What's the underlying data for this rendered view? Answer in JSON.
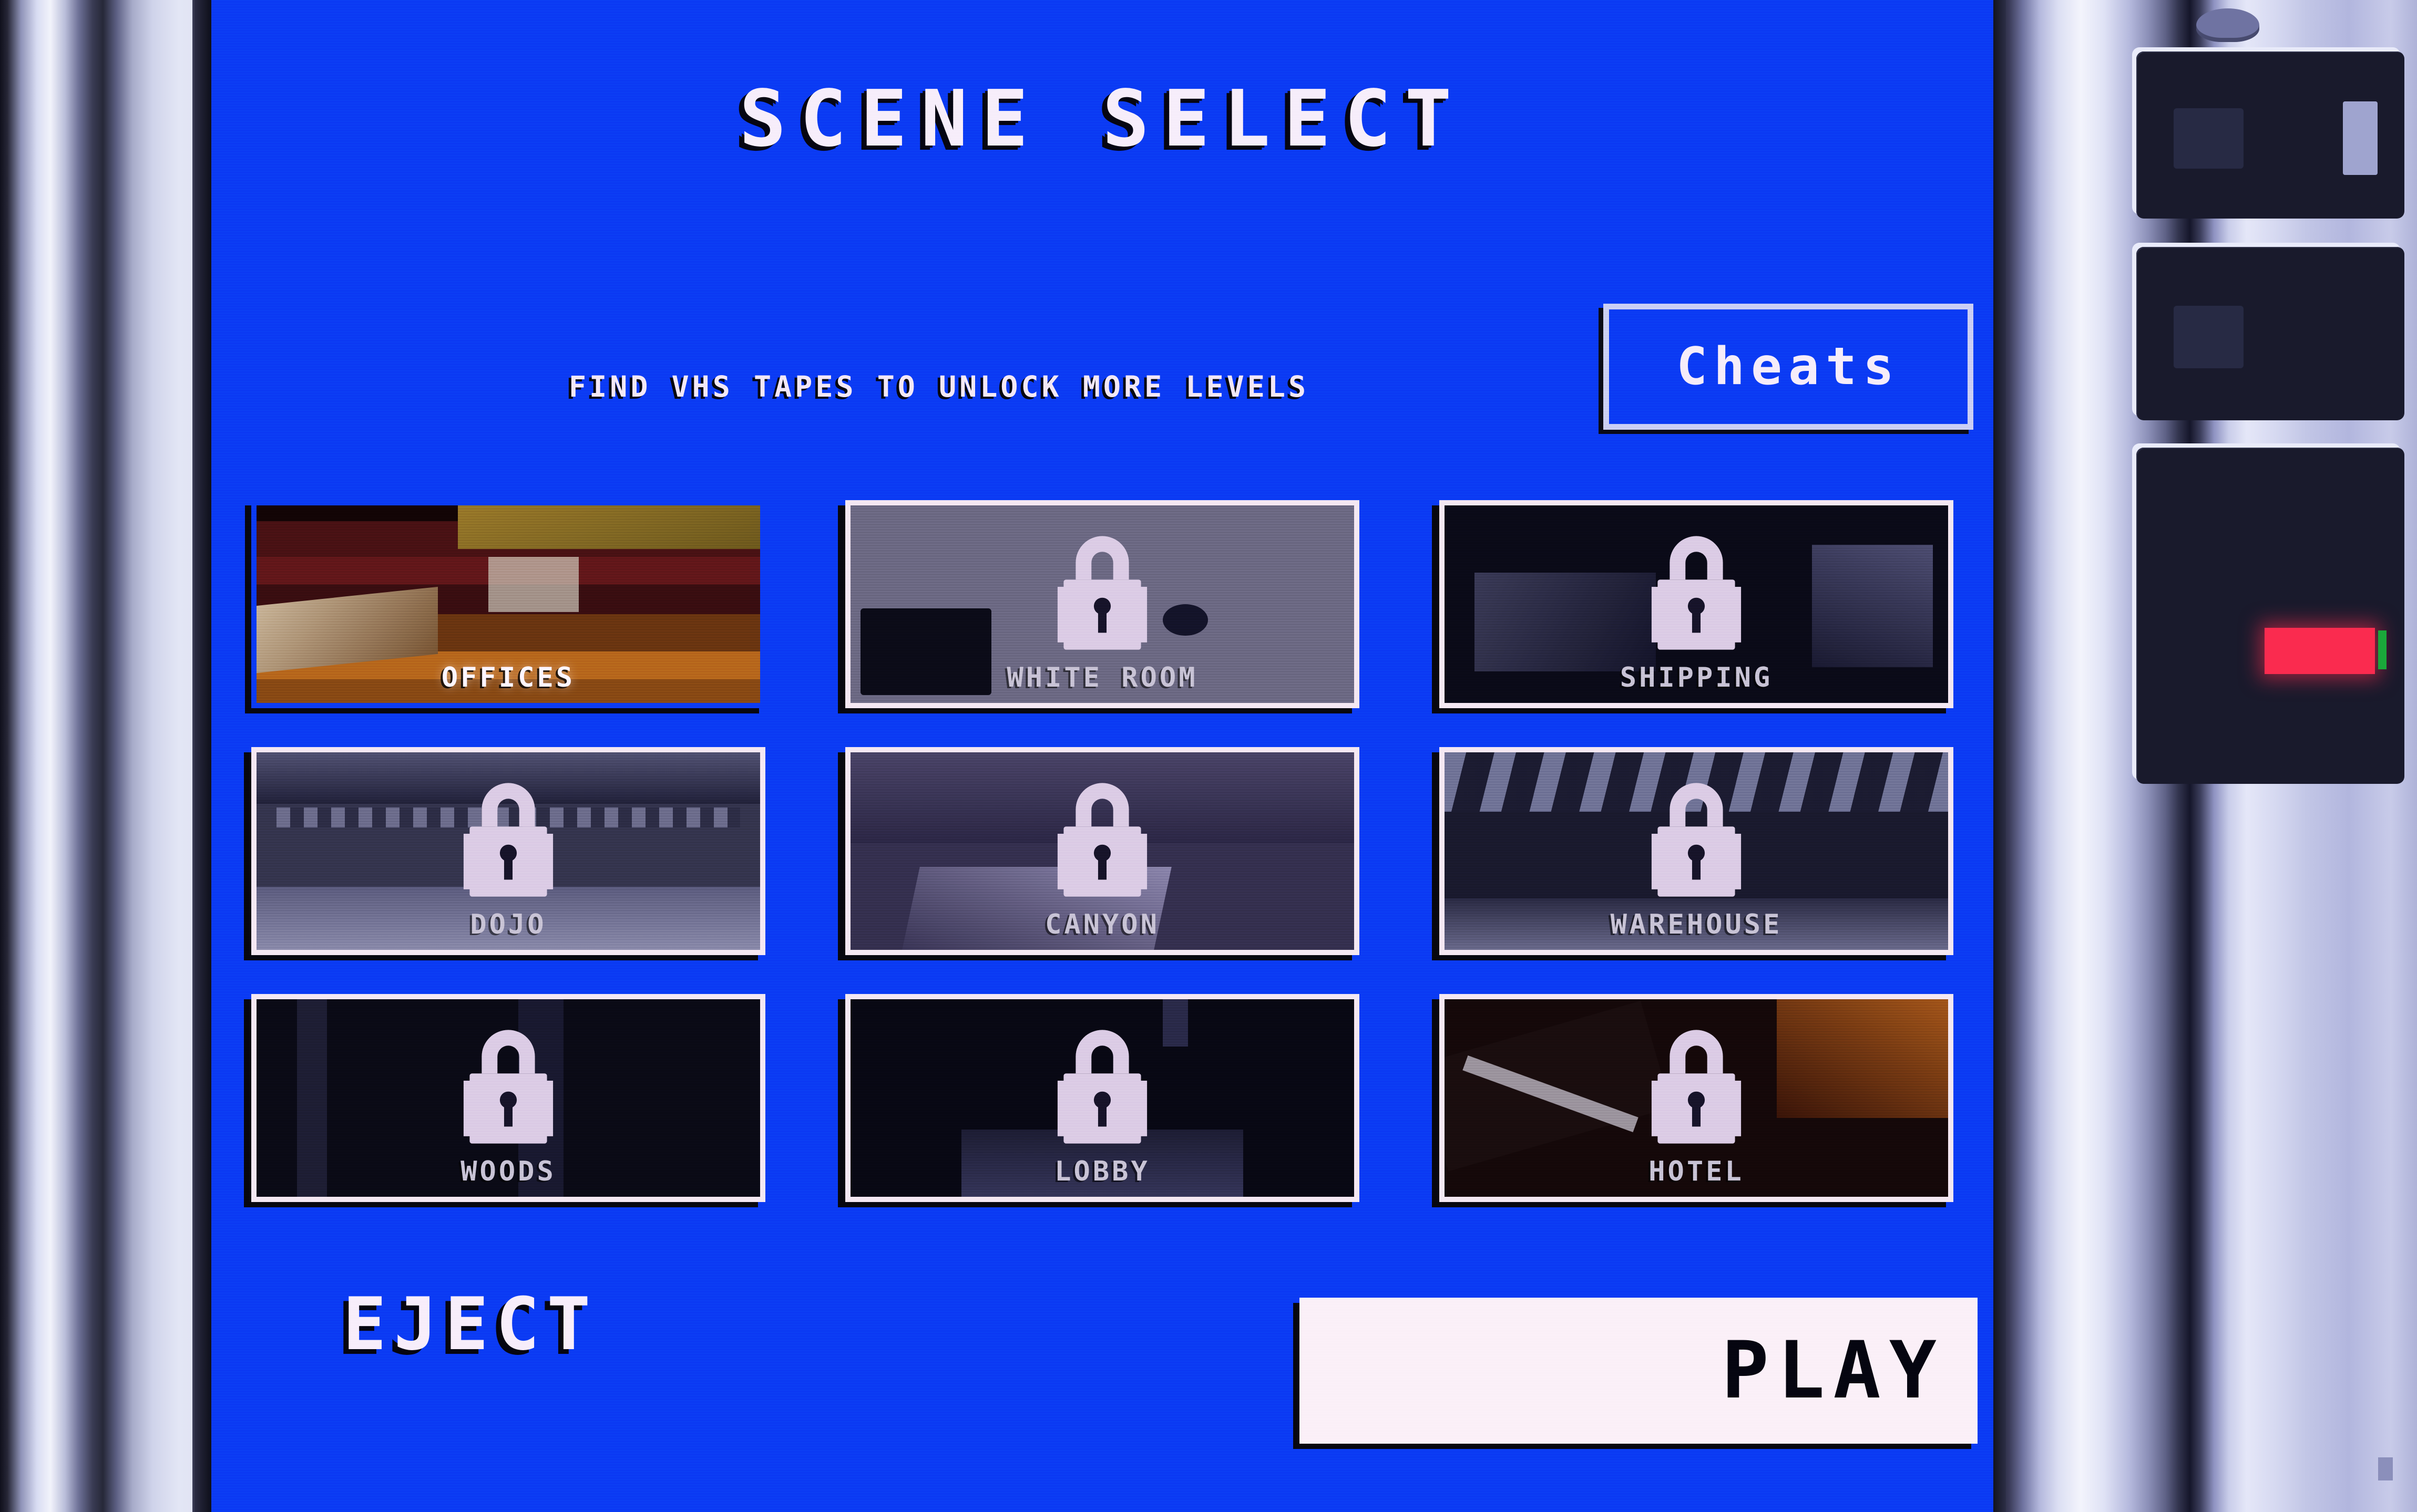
{
  "screen": {
    "background_color": "#0B3CF4",
    "title": "SCENE SELECT",
    "hint": "FIND VHS TAPES TO UNLOCK MORE LEVELS",
    "cheats_label": "Cheats"
  },
  "levels": [
    {
      "name": "OFFICES",
      "locked": false,
      "art": "art-offices",
      "selected": true
    },
    {
      "name": "WHITE ROOM",
      "locked": true,
      "art": "art-whiteroom",
      "selected": false
    },
    {
      "name": "SHIPPING",
      "locked": true,
      "art": "art-shipping",
      "selected": false
    },
    {
      "name": "DOJO",
      "locked": true,
      "art": "art-dojo",
      "selected": false
    },
    {
      "name": "CANYON",
      "locked": true,
      "art": "art-canyon",
      "selected": false
    },
    {
      "name": "WAREHOUSE",
      "locked": true,
      "art": "art-warehouse",
      "selected": false
    },
    {
      "name": "WOODS",
      "locked": true,
      "art": "art-woods",
      "selected": false
    },
    {
      "name": "LOBBY",
      "locked": true,
      "art": "art-lobby",
      "selected": false
    },
    {
      "name": "HOTEL",
      "locked": true,
      "art": "art-hotel",
      "selected": false
    }
  ],
  "actions": {
    "eject_label": "EJECT",
    "play_label": "PLAY"
  },
  "hardware": {
    "led_color": "#FA2B4F",
    "led_secondary_color": "#1AA83A",
    "bezel_color": "#C9CDEA"
  },
  "icons": {
    "lock": "padlock-icon",
    "lock_color": "#DCCDE6"
  }
}
